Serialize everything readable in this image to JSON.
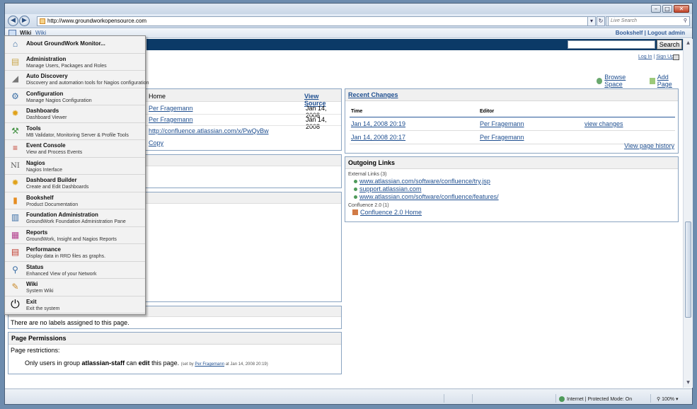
{
  "browser": {
    "address": "http://www.groundworkopensource.com",
    "search_placeholder": "Live Search",
    "tab_title": "Wiki",
    "tab_subtitle": "Wiki",
    "tab_right": "Bookshelf | Logout admin",
    "status_zone": "Internet | Protected Mode: On",
    "zoom": "100%"
  },
  "menu": {
    "items": [
      {
        "title": "About GroundWork Monitor...",
        "desc": "",
        "icon": "home-icon",
        "glyph": "⌂",
        "color": "#3a6ea5"
      },
      {
        "title": "Administration",
        "desc": "Manage Users, Packages and Roles",
        "icon": "administration-icon",
        "glyph": "▤",
        "color": "#c9a64a"
      },
      {
        "title": "Auto Discovery",
        "desc": "Discovery and automation tools for Nagios configuration",
        "icon": "satellite-icon",
        "glyph": "◢",
        "color": "#777777"
      },
      {
        "title": "Configuration",
        "desc": "Manage Nagios Configuration",
        "icon": "configuration-icon",
        "glyph": "⚙",
        "color": "#3a6ea5"
      },
      {
        "title": "Dashboards",
        "desc": "Dashboard Viewer",
        "icon": "dashboards-icon",
        "glyph": "✹",
        "color": "#e0a21a"
      },
      {
        "title": "Tools",
        "desc": "MB Validator, Monitoring Server & Profile Tools",
        "icon": "tools-icon",
        "glyph": "⚒",
        "color": "#3f8f3f"
      },
      {
        "title": "Event Console",
        "desc": "View and Process Events",
        "icon": "event-console-icon",
        "glyph": "≡",
        "color": "#c0392b"
      },
      {
        "title": "Nagios",
        "desc": "Nagios Interface",
        "icon": "nagios-icon",
        "glyph": "NI",
        "color": "#555555"
      },
      {
        "title": "Dashboard Builder",
        "desc": "Create and Edit Dashboards",
        "icon": "dashboard-builder-icon",
        "glyph": "✹",
        "color": "#e0a21a"
      },
      {
        "title": "Bookshelf",
        "desc": "Product Documentation",
        "icon": "bookshelf-icon",
        "glyph": "▮",
        "color": "#e58c1f"
      },
      {
        "title": "Foundation Administration",
        "desc": "GroundWork Foundation Administration Pane",
        "icon": "foundation-icon",
        "glyph": "▥",
        "color": "#3a6ea5"
      },
      {
        "title": "Reports",
        "desc": "GroundWork, Insight and Nagios Reports",
        "icon": "reports-icon",
        "glyph": "▦",
        "color": "#b03a8a"
      },
      {
        "title": "Performance",
        "desc": "Display data in RRD files as graphs.",
        "icon": "performance-icon",
        "glyph": "▤",
        "color": "#c0392b"
      },
      {
        "title": "Status",
        "desc": "Enhanced View of your Network",
        "icon": "status-icon",
        "glyph": "⚲",
        "color": "#3a6ea5"
      },
      {
        "title": "Wiki",
        "desc": "System Wiki",
        "icon": "wiki-icon",
        "glyph": "✎",
        "color": "#c98a2a"
      },
      {
        "title": "Exit",
        "desc": "Exit the system",
        "icon": "power-icon",
        "glyph": "⏻",
        "color": "#111111"
      }
    ]
  },
  "page": {
    "search_button": "Search",
    "login": "Log In",
    "signup": "Sign Up",
    "browse_space": "Browse Space",
    "add_page": "Add Page",
    "info": {
      "row1_label": "Home",
      "view_source": "View Source",
      "author1": "Per Fragemann",
      "date1": "Jan 14, 2008",
      "author2": "Per Fragemann",
      "date2": "Jan 14, 2008",
      "tiny_link": "http://confluence.atlassian.com/x/PwQvBw",
      "copy": "Copy"
    },
    "recent_changes": {
      "title": "Recent Changes",
      "headers": [
        "Time",
        "Editor",
        ""
      ],
      "rows": [
        {
          "time": "Jan 14, 2008 20:19",
          "editor": "Per Fragemann",
          "action": "view changes"
        },
        {
          "time": "Jan 14, 2008 20:17",
          "editor": "Per Fragemann",
          "action": ""
        }
      ],
      "history": "View page history"
    },
    "outgoing": {
      "title": "Outgoing Links",
      "group1": "External Links (3)",
      "links1": [
        "www.atlassian.com/software/confluence/try.jsp",
        "support.atlassian.com",
        "www.atlassian.com/software/confluence/features/"
      ],
      "group2": "Confluence 2.0 (1)",
      "links2": [
        "Confluence 2.0 Home"
      ]
    },
    "labels_text": "There are no labels assigned to this page.",
    "permissions": {
      "title": "Page Permissions",
      "restrictions": "Page restrictions:",
      "only_prefix": "Only users in group ",
      "group": "atlassian-staff",
      "can": " can ",
      "edit": "edit",
      "this_page": " this page.",
      "set_by_prefix": "(set by ",
      "set_by_user": "Per Fragemann",
      "set_by_suffix": " at Jan 14, 2008 20:19)"
    }
  }
}
